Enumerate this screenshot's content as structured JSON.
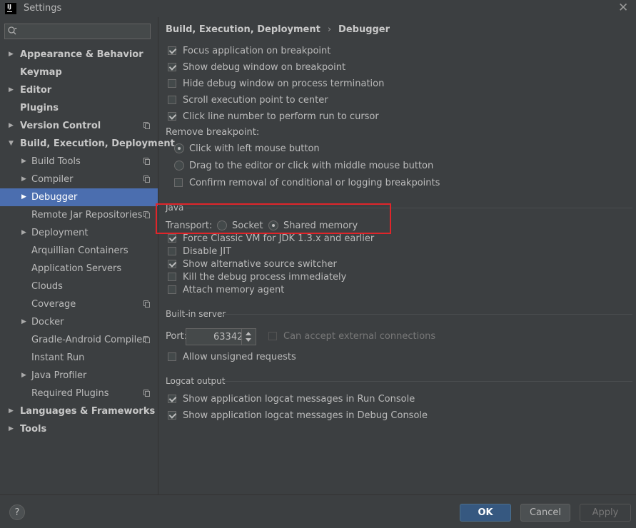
{
  "window": {
    "title": "Settings",
    "app_icon": "IJ"
  },
  "search": {
    "placeholder": ""
  },
  "sidebar": {
    "items": [
      {
        "label": "Appearance & Behavior"
      },
      {
        "label": "Keymap"
      },
      {
        "label": "Editor"
      },
      {
        "label": "Plugins"
      },
      {
        "label": "Version Control"
      },
      {
        "label": "Build, Execution, Deployment"
      },
      {
        "label": "Build Tools"
      },
      {
        "label": "Compiler"
      },
      {
        "label": "Debugger"
      },
      {
        "label": "Remote Jar Repositories"
      },
      {
        "label": "Deployment"
      },
      {
        "label": "Arquillian Containers"
      },
      {
        "label": "Application Servers"
      },
      {
        "label": "Clouds"
      },
      {
        "label": "Coverage"
      },
      {
        "label": "Docker"
      },
      {
        "label": "Gradle-Android Compiler"
      },
      {
        "label": "Instant Run"
      },
      {
        "label": "Java Profiler"
      },
      {
        "label": "Required Plugins"
      },
      {
        "label": "Languages & Frameworks"
      },
      {
        "label": "Tools"
      }
    ]
  },
  "breadcrumb": {
    "parent": "Build, Execution, Deployment",
    "separator": "›",
    "current": "Debugger"
  },
  "general": {
    "focus_app": {
      "label": "Focus application on breakpoint",
      "checked": true
    },
    "show_debug_window": {
      "label": "Show debug window on breakpoint",
      "checked": true
    },
    "hide_debug_window": {
      "label": "Hide debug window on process termination",
      "checked": false
    },
    "scroll_exec_point": {
      "label": "Scroll execution point to center",
      "checked": false
    },
    "click_line_number": {
      "label": "Click line number to perform run to cursor",
      "checked": true
    },
    "remove_breakpoint_label": "Remove breakpoint:",
    "remove_left_click": {
      "label": "Click with left mouse button",
      "selected": true
    },
    "remove_drag": {
      "label": "Drag to the editor or click with middle mouse button",
      "selected": false
    },
    "confirm_removal": {
      "label": "Confirm removal of conditional or logging breakpoints",
      "checked": false
    }
  },
  "java": {
    "section_title": "Java",
    "transport_label": "Transport:",
    "socket": {
      "label": "Socket",
      "selected": false
    },
    "shared_memory": {
      "label": "Shared memory",
      "selected": true
    },
    "force_classic": {
      "label": "Force Classic VM for JDK 1.3.x and earlier",
      "checked": true
    },
    "disable_jit": {
      "label": "Disable JIT",
      "checked": false
    },
    "show_alt_source": {
      "label": "Show alternative source switcher",
      "checked": true
    },
    "kill_debug": {
      "label": "Kill the debug process immediately",
      "checked": false
    },
    "attach_memory": {
      "label": "Attach memory agent",
      "checked": false
    }
  },
  "builtin_server": {
    "section_title": "Built-in server",
    "port_label": "Port:",
    "port_value": "63342",
    "external_connections": {
      "label": "Can accept external connections",
      "checked": false
    },
    "unsigned_requests": {
      "label": "Allow unsigned requests",
      "checked": false
    }
  },
  "logcat": {
    "section_title": "Logcat output",
    "run_console": {
      "label": "Show application logcat messages in Run Console",
      "checked": true
    },
    "debug_console": {
      "label": "Show application logcat messages in Debug Console",
      "checked": true
    }
  },
  "buttons": {
    "help": "?",
    "ok": "OK",
    "cancel": "Cancel",
    "apply": "Apply"
  },
  "colors": {
    "selection": "#4b6eaf",
    "highlight_box": "#e0252a",
    "ok_button": "#365880"
  }
}
